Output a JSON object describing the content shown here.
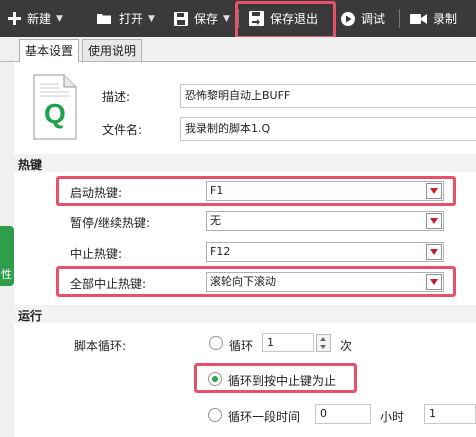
{
  "toolbar": {
    "new_label": "新建",
    "open_label": "打开",
    "save_label": "保存",
    "save_exit_label": "保存退出",
    "debug_label": "调试",
    "record_label": "录制"
  },
  "tabs": {
    "basic_settings": "基本设置",
    "usage_notes": "使用说明"
  },
  "side_tab_label": "性",
  "file_icon_letter": "Q",
  "basic": {
    "description_label": "描述:",
    "description_value": "恐怖黎明自动上BUFF",
    "filename_label": "文件名:",
    "filename_value": "我录制的脚本1.Q"
  },
  "hotkeys": {
    "section_title": "热键",
    "start_label": "启动热键:",
    "start_value": "F1",
    "pause_label": "暂停/继续热键:",
    "pause_value": "无",
    "stop_label": "中止热键:",
    "stop_value": "F12",
    "stop_all_label": "全部中止热键:",
    "stop_all_value": "滚轮向下滚动"
  },
  "run": {
    "section_title": "运行",
    "loop_label": "脚本循环:",
    "loop_option": "循环",
    "loop_count": "1",
    "loop_unit": "次",
    "until_stop_option": "循环到按中止键为止",
    "duration_option": "循环一段时间",
    "hours_value": "0",
    "hours_unit": "小时",
    "minutes_value": "1",
    "selected_option": "循环到按中止键为止"
  },
  "colors": {
    "highlight": "#e8516a",
    "toolbar_bg": "#3a3a3a",
    "accent_green": "#2e9e4a",
    "dropdown_arrow": "#c0202a"
  }
}
